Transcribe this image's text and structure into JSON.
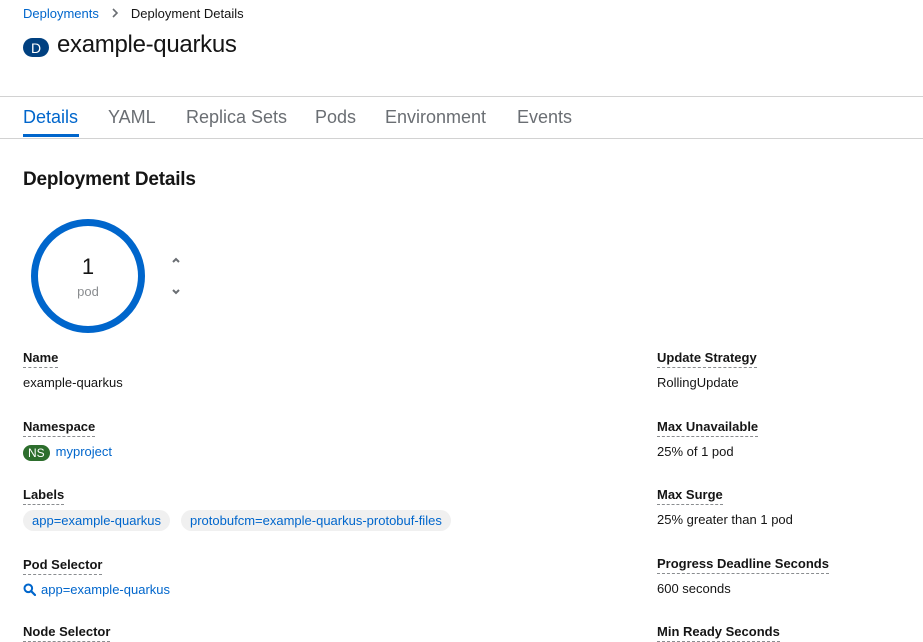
{
  "breadcrumb": {
    "parent": "Deployments",
    "current": "Deployment Details"
  },
  "header": {
    "kind_badge": "D",
    "title": "example-quarkus"
  },
  "tabs": [
    {
      "label": "Details",
      "active": true
    },
    {
      "label": "YAML"
    },
    {
      "label": "Replica Sets"
    },
    {
      "label": "Pods"
    },
    {
      "label": "Environment"
    },
    {
      "label": "Events"
    }
  ],
  "section": {
    "title": "Deployment Details"
  },
  "pods": {
    "count": "1",
    "unit": "pod",
    "ring_color": "#0066cc"
  },
  "details_left": {
    "name_label": "Name",
    "name_value": "example-quarkus",
    "namespace_label": "Namespace",
    "namespace_badge": "NS",
    "namespace_value": "myproject",
    "labels_label": "Labels",
    "labels": [
      "app=example-quarkus",
      "protobufcm=example-quarkus-protobuf-files"
    ],
    "pod_selector_label": "Pod Selector",
    "pod_selector_value": "app=example-quarkus",
    "node_selector_label": "Node Selector"
  },
  "details_right": {
    "update_strategy_label": "Update Strategy",
    "update_strategy_value": "RollingUpdate",
    "max_unavailable_label": "Max Unavailable",
    "max_unavailable_value": "25% of 1 pod",
    "max_surge_label": "Max Surge",
    "max_surge_value": "25% greater than 1 pod",
    "progress_deadline_label": "Progress Deadline Seconds",
    "progress_deadline_value": "600 seconds",
    "min_ready_label": "Min Ready Seconds"
  },
  "icons": {
    "breadcrumb_separator": "chevron-right-icon",
    "scale_up": "chevron-up-icon",
    "scale_down": "chevron-down-icon",
    "selector": "search-icon"
  },
  "colors": {
    "link": "#0066cc",
    "namespace_badge": "#2d6e2d",
    "kind_badge": "#004080"
  }
}
